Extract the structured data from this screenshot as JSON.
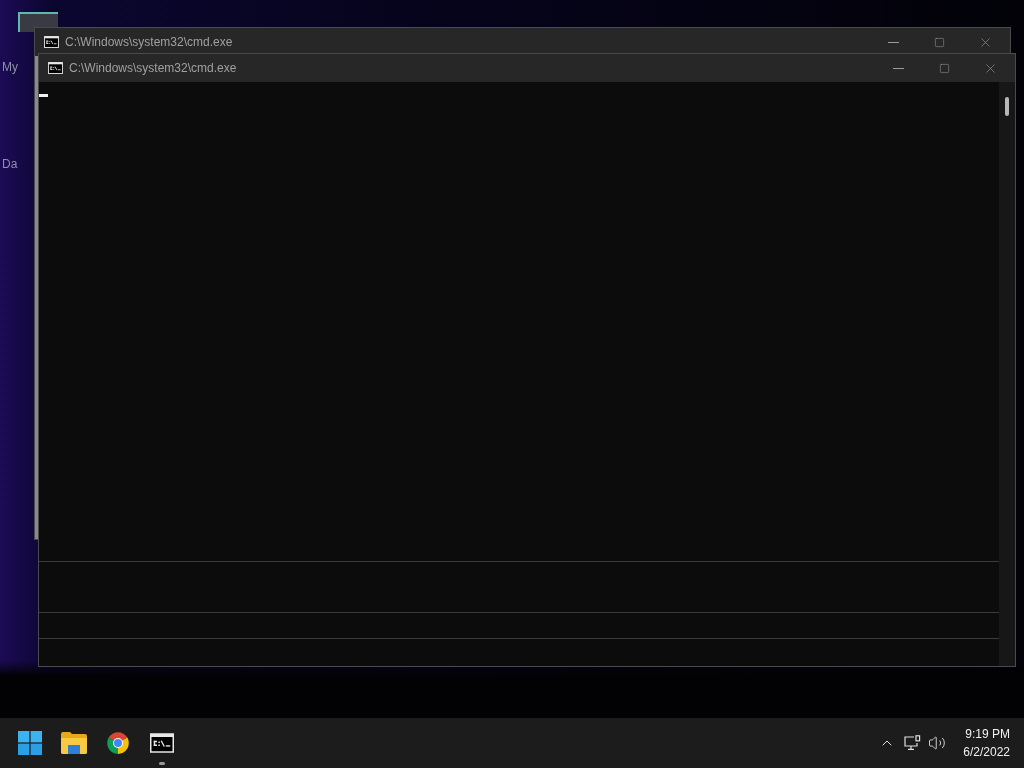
{
  "desktop": {
    "icons": [
      {
        "label": "My"
      },
      {
        "label": "Da"
      }
    ]
  },
  "windows": [
    {
      "title": "C:\\Windows\\system32\\cmd.exe"
    },
    {
      "title": "C:\\Windows\\system32\\cmd.exe"
    }
  ],
  "taskbar": {
    "apps": [
      {
        "kind": "start",
        "running": false
      },
      {
        "kind": "folder",
        "running": false
      },
      {
        "kind": "browser",
        "running": false
      },
      {
        "kind": "terminal",
        "running": true
      }
    ],
    "clock": {
      "time": "9:19 PM",
      "date": "6/2/2022"
    }
  }
}
